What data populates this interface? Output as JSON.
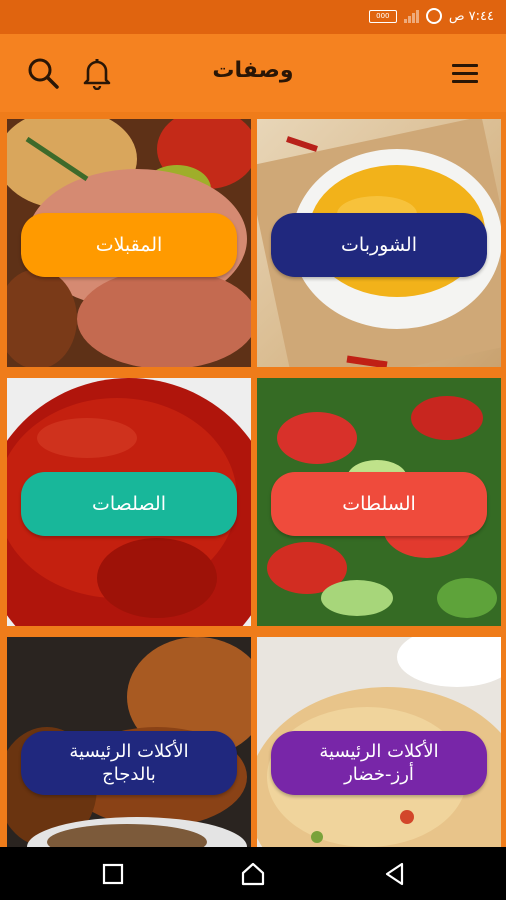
{
  "status_bar": {
    "time": "٧:٤٤ ص",
    "battery_label": "000",
    "icons": [
      "alarm-icon",
      "signal-icon",
      "battery-icon"
    ]
  },
  "app_bar": {
    "title": "وصفات",
    "icons": [
      "menu-icon",
      "search-icon",
      "bell-icon"
    ],
    "color": "#f58220"
  },
  "categories": [
    {
      "label": "الشوربات",
      "color": "#20287e"
    },
    {
      "label": "المقبلات",
      "color": "#ff9a00"
    },
    {
      "label": "السلطات",
      "color": "#ef4b3c"
    },
    {
      "label": "الصلصات",
      "color": "#18b79a"
    },
    {
      "label": "الأكلات الرئيسية\nأرز-خضار",
      "color": "#7826a8"
    },
    {
      "label": "الأكلات الرئيسية\nبالدجاج",
      "color": "#20287e"
    }
  ],
  "nav_bar": {
    "icons": [
      "recent-apps-icon",
      "home-icon",
      "back-icon"
    ]
  }
}
